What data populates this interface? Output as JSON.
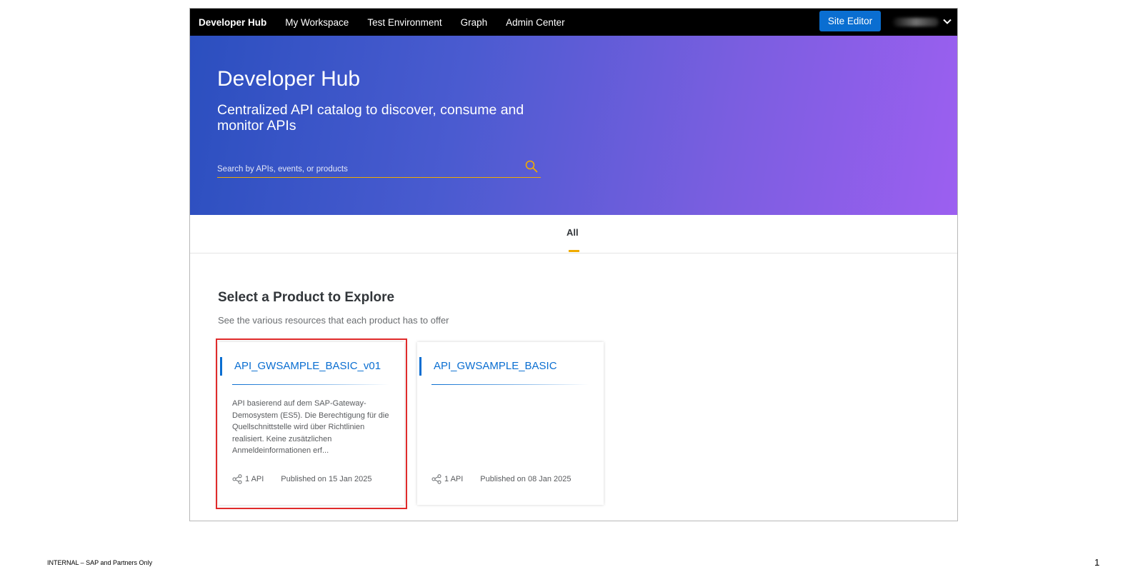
{
  "topnav": {
    "brand": "Developer Hub",
    "links": [
      "My Workspace",
      "Test Environment",
      "Graph",
      "Admin Center"
    ],
    "site_editor_label": "Site Editor"
  },
  "hero": {
    "title": "Developer Hub",
    "subtitle": "Centralized API catalog to discover, consume and monitor APIs",
    "search_placeholder": "Search by APIs, events, or products"
  },
  "tabs": [
    {
      "label": "All",
      "active": true
    }
  ],
  "section": {
    "title": "Select a Product to Explore",
    "subtitle": "See the various resources that each product has to offer"
  },
  "cards": [
    {
      "title": "API_GWSAMPLE_BASIC_v01",
      "description": "API basierend auf dem SAP-Gateway-Demosystem (ES5).  Die Berechtigung für die Quellschnittstelle wird über Richtlinien realisiert. Keine zusätzlichen Anmeldeinformationen erf...",
      "api_count": "1 API",
      "published": "Published on 15 Jan 2025",
      "highlighted": true
    },
    {
      "title": "API_GWSAMPLE_BASIC",
      "description": "",
      "api_count": "1 API",
      "published": "Published on 08 Jan 2025",
      "highlighted": false
    }
  ],
  "colors": {
    "accent_blue": "#0a6ed1",
    "tab_accent": "#f0ab00",
    "highlight_red": "#e02b2b",
    "hero_gradient_start": "#2b4fbf",
    "hero_gradient_end": "#9c5ff0"
  },
  "icons": [
    "search-icon",
    "chevron-down-icon",
    "share-icon"
  ],
  "footer": {
    "note": "INTERNAL – SAP and Partners Only",
    "page_number": "1"
  }
}
